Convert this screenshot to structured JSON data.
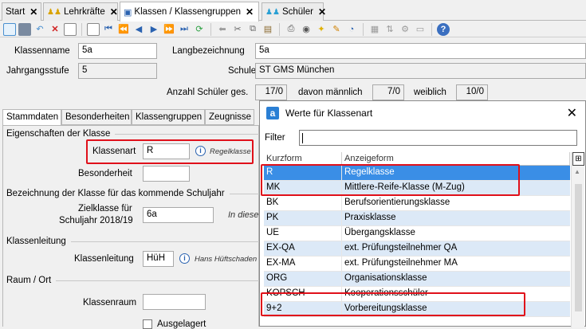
{
  "tabs": [
    {
      "label": "Start",
      "close": "✕"
    },
    {
      "label": "Lehrkräfte",
      "close": "✕"
    },
    {
      "label": "Klassen / Klassengruppen",
      "close": "✕"
    },
    {
      "label": "Schüler",
      "close": "✕"
    }
  ],
  "header": {
    "klassenname_label": "Klassenname",
    "klassenname_value": "5a",
    "langbezeichnung_label": "Langbezeichnung",
    "langbezeichnung_value": "5a",
    "jahrgangsstufe_label": "Jahrgangsstufe",
    "jahrgangsstufe_value": "5",
    "schule_label": "Schule",
    "schule_value": "ST GMS München",
    "anzahl_label": "Anzahl Schüler ges.",
    "anzahl_value": "17/0",
    "maennlich_label": "davon männlich",
    "maennlich_value": "7/0",
    "weiblich_label": "weiblich",
    "weiblich_value": "10/0"
  },
  "subtabs": [
    "Stammdaten",
    "Besonderheiten",
    "Klassengruppen",
    "Zeugnisse"
  ],
  "stammdaten": {
    "section_eigenschaften": "Eigenschaften der Klasse",
    "klassenart_label": "Klassenart",
    "klassenart_value": "R",
    "klassenart_hint": "Regelklasse",
    "besonderheit_label": "Besonderheit",
    "section_bezeichnung": "Bezeichnung der Klasse für das kommende Schuljahr",
    "zielklasse_label1": "Zielklasse für",
    "zielklasse_label2": "Schuljahr 2018/19",
    "zielklasse_value": "6a",
    "zielklasse_hint": "In diese",
    "section_leitung": "Klassenleitung",
    "klassenleitung_label": "Klassenleitung",
    "klassenleitung_value": "HüH",
    "klassenleitung_hint": "Hans Hüftschaden",
    "section_raum": "Raum / Ort",
    "klassenraum_label": "Klassenraum",
    "ausgelagert_label": "Ausgelagert"
  },
  "dialog": {
    "logo": "a",
    "title": "Werte für Klassenart",
    "filter_label": "Filter",
    "col_kurzform": "Kurzform",
    "col_anzeigeform": "Anzeigeform",
    "rows": [
      {
        "kurz": "R",
        "anzeige": "Regelklasse"
      },
      {
        "kurz": "MK",
        "anzeige": "Mittlere-Reife-Klasse (M-Zug)"
      },
      {
        "kurz": "BK",
        "anzeige": "Berufsorientierungsklasse"
      },
      {
        "kurz": "PK",
        "anzeige": "Praxisklasse"
      },
      {
        "kurz": "UE",
        "anzeige": "Übergangsklasse"
      },
      {
        "kurz": "EX-QA",
        "anzeige": "ext. Prüfungsteilnehmer QA"
      },
      {
        "kurz": "EX-MA",
        "anzeige": "ext. Prüfungsteilnehmer MA"
      },
      {
        "kurz": "ORG",
        "anzeige": "Organisationsklasse"
      },
      {
        "kurz": "KOPSCH",
        "anzeige": "Kooperationsschüler"
      },
      {
        "kurz": "9+2",
        "anzeige": "Vorbereitungsklasse"
      }
    ]
  },
  "colors": {
    "accent": "#3a8ee6",
    "highlight": "#e0101a",
    "row_alt": "#dce9f7"
  }
}
